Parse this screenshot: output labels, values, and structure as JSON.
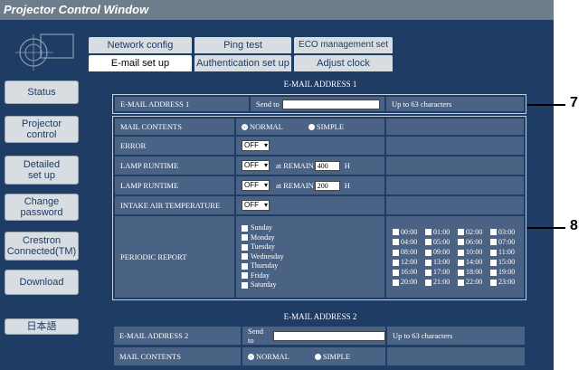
{
  "window_title": "Projector Control Window",
  "sidebar": {
    "status": "Status",
    "projector_control": "Projector\ncontrol",
    "detailed_setup": "Detailed\nset up",
    "change_password": "Change\npassword",
    "crestron": "Crestron\nConnected(TM)",
    "download": "Download",
    "language": "日本語"
  },
  "tabs": {
    "network_config": "Network config",
    "ping_test": "Ping test",
    "eco_setup": "ECO management set up",
    "email_setup": "E-mail set up",
    "auth_setup": "Authentication set up",
    "adjust_clock": "Adjust clock"
  },
  "email1": {
    "header": "E-MAIL ADDRESS 1",
    "label": "E-MAIL ADDRESS 1",
    "send_to": "Send to",
    "value": "",
    "limit": "Up to 63 characters"
  },
  "settings": {
    "mail_contents_label": "MAIL CONTENTS",
    "normal": "NORMAL",
    "simple": "SIMPLE",
    "error_label": "ERROR",
    "error_value": "OFF",
    "lamp1_label": "LAMP RUNTIME",
    "lamp1_value": "OFF",
    "lamp1_remain_label": "at REMAIN",
    "lamp1_remain_value": "400",
    "lamp1_unit": "H",
    "lamp2_label": "LAMP RUNTIME",
    "lamp2_value": "OFF",
    "lamp2_remain_label": "at REMAIN",
    "lamp2_remain_value": "200",
    "lamp2_unit": "H",
    "intake_label": "INTAKE AIR TEMPERATURE",
    "intake_value": "OFF",
    "periodic_label": "PERIODIC REPORT",
    "days": [
      "Sunday",
      "Monday",
      "Tuesday",
      "Wednesday",
      "Thursday",
      "Friday",
      "Saturday"
    ],
    "hours": [
      "00:00",
      "01:00",
      "02:00",
      "03:00",
      "04:00",
      "05:00",
      "06:00",
      "07:00",
      "08:00",
      "09:00",
      "10:00",
      "11:00",
      "12:00",
      "13:00",
      "14:00",
      "15:00",
      "16:00",
      "17:00",
      "18:00",
      "19:00",
      "20:00",
      "21:00",
      "22:00",
      "23:00"
    ]
  },
  "email2": {
    "header": "E-MAIL ADDRESS 2",
    "label": "E-MAIL ADDRESS 2",
    "send_to": "Send to",
    "value": "",
    "limit": "Up to 63 characters",
    "mail_contents_label": "MAIL CONTENTS",
    "normal": "NORMAL",
    "simple": "SIMPLE"
  },
  "callouts": {
    "seven": "7",
    "eight": "8"
  },
  "colors": {
    "frame": "#1e3c64",
    "cell": "#4a6385",
    "nav": "#d8dde2"
  }
}
